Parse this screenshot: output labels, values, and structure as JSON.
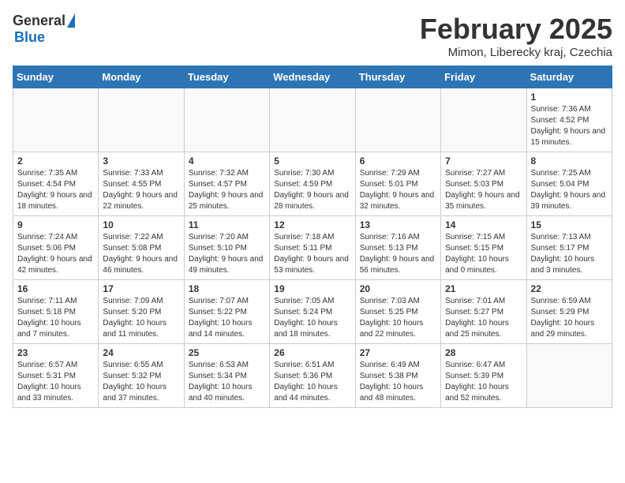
{
  "logo": {
    "general": "General",
    "blue": "Blue"
  },
  "title": "February 2025",
  "subtitle": "Mimon, Liberecky kraj, Czechia",
  "days_of_week": [
    "Sunday",
    "Monday",
    "Tuesday",
    "Wednesday",
    "Thursday",
    "Friday",
    "Saturday"
  ],
  "weeks": [
    [
      {
        "day": "",
        "info": ""
      },
      {
        "day": "",
        "info": ""
      },
      {
        "day": "",
        "info": ""
      },
      {
        "day": "",
        "info": ""
      },
      {
        "day": "",
        "info": ""
      },
      {
        "day": "",
        "info": ""
      },
      {
        "day": "1",
        "info": "Sunrise: 7:36 AM\nSunset: 4:52 PM\nDaylight: 9 hours and 15 minutes."
      }
    ],
    [
      {
        "day": "2",
        "info": "Sunrise: 7:35 AM\nSunset: 4:54 PM\nDaylight: 9 hours and 18 minutes."
      },
      {
        "day": "3",
        "info": "Sunrise: 7:33 AM\nSunset: 4:55 PM\nDaylight: 9 hours and 22 minutes."
      },
      {
        "day": "4",
        "info": "Sunrise: 7:32 AM\nSunset: 4:57 PM\nDaylight: 9 hours and 25 minutes."
      },
      {
        "day": "5",
        "info": "Sunrise: 7:30 AM\nSunset: 4:59 PM\nDaylight: 9 hours and 28 minutes."
      },
      {
        "day": "6",
        "info": "Sunrise: 7:29 AM\nSunset: 5:01 PM\nDaylight: 9 hours and 32 minutes."
      },
      {
        "day": "7",
        "info": "Sunrise: 7:27 AM\nSunset: 5:03 PM\nDaylight: 9 hours and 35 minutes."
      },
      {
        "day": "8",
        "info": "Sunrise: 7:25 AM\nSunset: 5:04 PM\nDaylight: 9 hours and 39 minutes."
      }
    ],
    [
      {
        "day": "9",
        "info": "Sunrise: 7:24 AM\nSunset: 5:06 PM\nDaylight: 9 hours and 42 minutes."
      },
      {
        "day": "10",
        "info": "Sunrise: 7:22 AM\nSunset: 5:08 PM\nDaylight: 9 hours and 46 minutes."
      },
      {
        "day": "11",
        "info": "Sunrise: 7:20 AM\nSunset: 5:10 PM\nDaylight: 9 hours and 49 minutes."
      },
      {
        "day": "12",
        "info": "Sunrise: 7:18 AM\nSunset: 5:11 PM\nDaylight: 9 hours and 53 minutes."
      },
      {
        "day": "13",
        "info": "Sunrise: 7:16 AM\nSunset: 5:13 PM\nDaylight: 9 hours and 56 minutes."
      },
      {
        "day": "14",
        "info": "Sunrise: 7:15 AM\nSunset: 5:15 PM\nDaylight: 10 hours and 0 minutes."
      },
      {
        "day": "15",
        "info": "Sunrise: 7:13 AM\nSunset: 5:17 PM\nDaylight: 10 hours and 3 minutes."
      }
    ],
    [
      {
        "day": "16",
        "info": "Sunrise: 7:11 AM\nSunset: 5:18 PM\nDaylight: 10 hours and 7 minutes."
      },
      {
        "day": "17",
        "info": "Sunrise: 7:09 AM\nSunset: 5:20 PM\nDaylight: 10 hours and 11 minutes."
      },
      {
        "day": "18",
        "info": "Sunrise: 7:07 AM\nSunset: 5:22 PM\nDaylight: 10 hours and 14 minutes."
      },
      {
        "day": "19",
        "info": "Sunrise: 7:05 AM\nSunset: 5:24 PM\nDaylight: 10 hours and 18 minutes."
      },
      {
        "day": "20",
        "info": "Sunrise: 7:03 AM\nSunset: 5:25 PM\nDaylight: 10 hours and 22 minutes."
      },
      {
        "day": "21",
        "info": "Sunrise: 7:01 AM\nSunset: 5:27 PM\nDaylight: 10 hours and 25 minutes."
      },
      {
        "day": "22",
        "info": "Sunrise: 6:59 AM\nSunset: 5:29 PM\nDaylight: 10 hours and 29 minutes."
      }
    ],
    [
      {
        "day": "23",
        "info": "Sunrise: 6:57 AM\nSunset: 5:31 PM\nDaylight: 10 hours and 33 minutes."
      },
      {
        "day": "24",
        "info": "Sunrise: 6:55 AM\nSunset: 5:32 PM\nDaylight: 10 hours and 37 minutes."
      },
      {
        "day": "25",
        "info": "Sunrise: 6:53 AM\nSunset: 5:34 PM\nDaylight: 10 hours and 40 minutes."
      },
      {
        "day": "26",
        "info": "Sunrise: 6:51 AM\nSunset: 5:36 PM\nDaylight: 10 hours and 44 minutes."
      },
      {
        "day": "27",
        "info": "Sunrise: 6:49 AM\nSunset: 5:38 PM\nDaylight: 10 hours and 48 minutes."
      },
      {
        "day": "28",
        "info": "Sunrise: 6:47 AM\nSunset: 5:39 PM\nDaylight: 10 hours and 52 minutes."
      },
      {
        "day": "",
        "info": ""
      }
    ]
  ]
}
